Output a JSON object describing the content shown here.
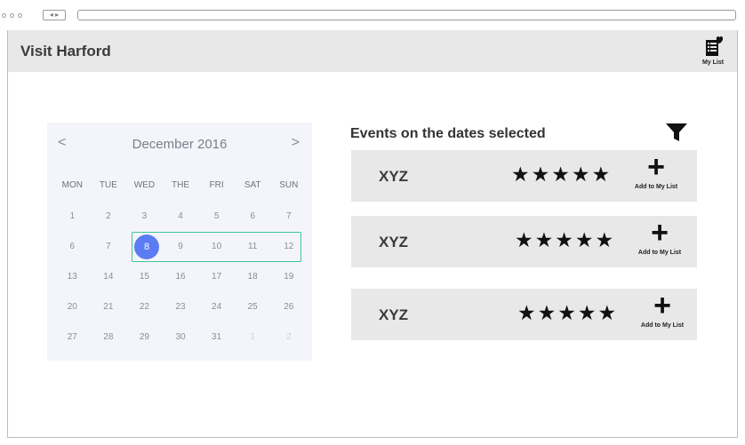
{
  "browser": {
    "nav_label": "◂ ▸"
  },
  "header": {
    "title": "Visit Harford",
    "my_list_label": "My List"
  },
  "calendar": {
    "prev": "<",
    "next": ">",
    "month": "December 2016",
    "weekdays": [
      "MON",
      "TUE",
      "WED",
      "THE",
      "FRI",
      "SAT",
      "SUN"
    ],
    "weeks": [
      [
        "1",
        "2",
        "3",
        "4",
        "5",
        "6",
        "7"
      ],
      [
        "6",
        "7",
        "8",
        "9",
        "10",
        "11",
        "12"
      ],
      [
        "13",
        "14",
        "15",
        "16",
        "17",
        "18",
        "19"
      ],
      [
        "20",
        "21",
        "22",
        "23",
        "24",
        "25",
        "26"
      ],
      [
        "27",
        "28",
        "29",
        "30",
        "31",
        "1",
        "2"
      ]
    ],
    "selected_day": "8",
    "accent": "#5b7cf2",
    "range_color": "#3fc39b"
  },
  "events": {
    "title": "Events on the dates selected",
    "filter_icon": "funnel-icon",
    "items": [
      {
        "name": "XYZ",
        "stars": "★★★★★",
        "add_label": "Add to My List"
      },
      {
        "name": "XYZ",
        "stars": "★★★★★",
        "add_label": "Add to My List"
      },
      {
        "name": "XYZ",
        "stars": "★★★★★",
        "add_label": "Add to My List"
      }
    ],
    "add_symbol": "+"
  }
}
